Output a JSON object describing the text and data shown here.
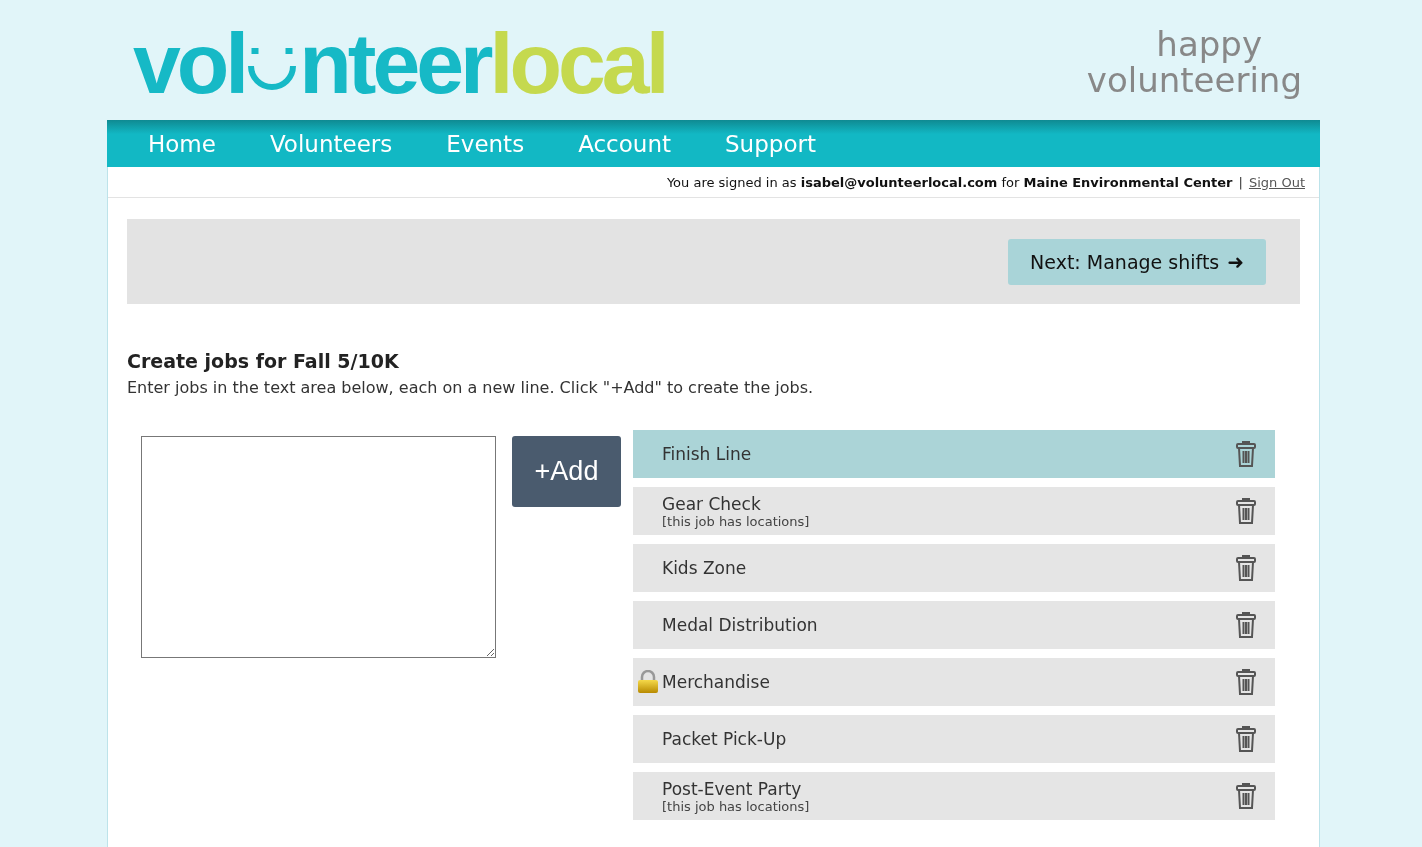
{
  "logo": {
    "part_1": "vol",
    "part_2": "nteer",
    "part_3": "local"
  },
  "tagline": [
    "happy",
    "volunteering"
  ],
  "nav": [
    {
      "label": "Home"
    },
    {
      "label": "Volunteers"
    },
    {
      "label": "Events"
    },
    {
      "label": "Account"
    },
    {
      "label": "Support"
    }
  ],
  "account_bar": {
    "text": "You are signed in as **isabel@volunteerlocal.com** for **Maine Environmental Center**",
    "separator": "|",
    "sign_out": "Sign Out"
  },
  "next_button": {
    "label": "Next: Manage shifts",
    "arrow": "➜"
  },
  "heading": "Create jobs for Fall 5/10K",
  "instructions": "Enter jobs in the text area below, each on a new line. Click \"+Add\" to create the jobs.",
  "add_button": "+Add",
  "jobs": [
    {
      "name": "Finish Line",
      "selected": true,
      "locked": false
    },
    {
      "name": "Gear Check",
      "note": "[this job has locations]",
      "selected": false,
      "locked": false
    },
    {
      "name": "Kids Zone",
      "selected": false,
      "locked": false
    },
    {
      "name": "Medal Distribution",
      "selected": false,
      "locked": false
    },
    {
      "name": "Merchandise",
      "selected": false,
      "locked": true
    },
    {
      "name": "Packet Pick-Up",
      "selected": false,
      "locked": false
    },
    {
      "name": "Post-Event Party",
      "note": "[this job has locations]",
      "selected": false,
      "locked": false
    }
  ]
}
